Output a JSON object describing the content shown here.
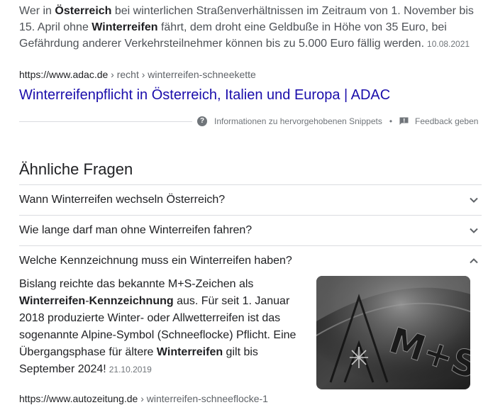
{
  "snippet": {
    "t1": "Wer in ",
    "b1": "Österreich",
    "t2": " bei winterlichen Straßenverhältnissen im Zeitraum von 1. November bis 15. April ohne ",
    "b2": "Winterreifen",
    "t3": " fährt, dem droht eine Geldbuße in Höhe von 35 Euro, bei Gefährdung anderer Verkehrsteilnehmer können bis zu 5.000 Euro fällig werden.",
    "date": "10.08.2021"
  },
  "result": {
    "site": "https://www.adac.de",
    "path": " › recht › winterreifen-schneekette",
    "title": "Winterreifenpflicht in Österreich, Italien und Europa | ADAC"
  },
  "snippet_footer": {
    "info_icon": "help-circle-icon",
    "info_label": "Informationen zu hervorgehobenen Snippets",
    "separator": "•",
    "feedback_icon": "feedback-icon",
    "feedback_label": "Feedback geben"
  },
  "paa": {
    "title": "Ähnliche Fragen",
    "questions": [
      {
        "text": "Wann Winterreifen wechseln Österreich?",
        "expanded": false
      },
      {
        "text": "Wie lange darf man ohne Winterreifen fahren?",
        "expanded": false
      },
      {
        "text": "Welche Kennzeichnung muss ein Winterreifen haben?",
        "expanded": true
      }
    ],
    "answer": {
      "t1": "Bislang reichte das bekannte M+S-Zeichen als ",
      "b1": "Winterreifen",
      "t2": "-",
      "b2": "Kennzeichnung",
      "t3": " aus. Für seit 1. Januar 2018 produzierte Winter- oder Allwetterreifen ist das sogenannte Alpine-Symbol (Schneeflocke) Pflicht. Eine Übergangsphase für ältere ",
      "b3": "Winterreifen",
      "t4": " gilt bis September 2024!",
      "date": "21.10.2019",
      "image_label": "M+S"
    },
    "next_site": "https://www.autozeitung.de",
    "next_path": " › winterreifen-schneeflocke-1"
  },
  "colors": {
    "link": "#1a0dab",
    "text": "#202124",
    "muted": "#70757a",
    "divider": "#dadce0"
  }
}
